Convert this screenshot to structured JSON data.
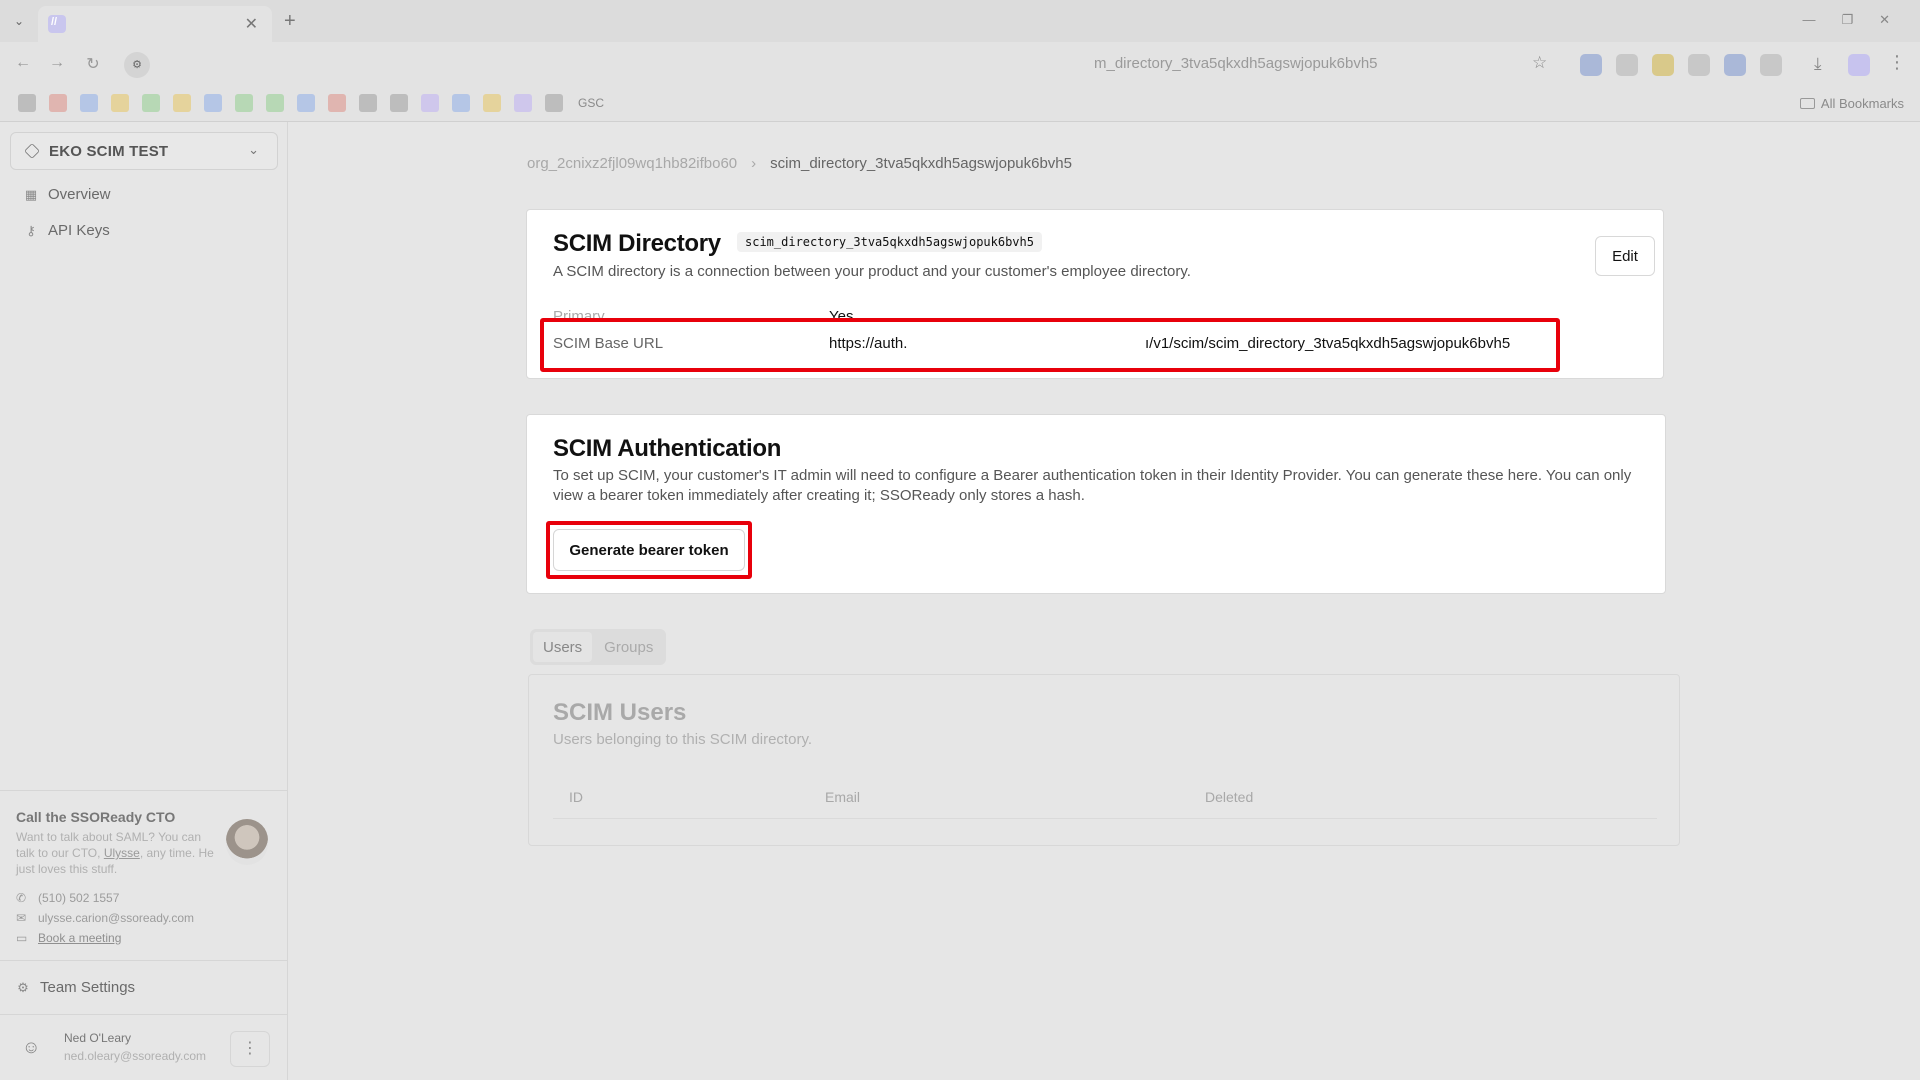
{
  "browser": {
    "tab_title": "",
    "url": "m_directory_3tva5qkxdh5agswjopuk6bvh5",
    "bookmark_gsc": "GSC",
    "all_bookmarks": "All Bookmarks"
  },
  "sidebar": {
    "org_name": "EKO SCIM TEST",
    "nav": [
      {
        "label": "Overview",
        "icon": "grid-icon"
      },
      {
        "label": "API Keys",
        "icon": "key-icon"
      }
    ],
    "cto": {
      "title": "Call the SSOReady CTO",
      "text_before": "Want to talk about SAML? You can talk to our CTO, ",
      "text_link": "Ulysse",
      "text_after": ", any time. He just loves this stuff.",
      "phone": "(510) 502 1557",
      "email": "ulysse.carion@ssoready.com",
      "meeting": "Book a meeting"
    },
    "team_settings": "Team Settings",
    "user": {
      "name": "Ned O'Leary",
      "email": "ned.oleary@ssoready.com"
    }
  },
  "breadcrumb": {
    "org": "org_2cnixz2fjl09wq1hb82ifbo60",
    "separator": "›",
    "current": "scim_directory_3tva5qkxdh5agswjopuk6bvh5"
  },
  "directory": {
    "title": "SCIM Directory",
    "id": "scim_directory_3tva5qkxdh5agswjopuk6bvh5",
    "description": "A SCIM directory is a connection between your product and your customer's employee directory.",
    "edit_label": "Edit",
    "primary_label": "Primary",
    "primary_value": "Yes",
    "base_url_label": "SCIM Base URL",
    "base_url_start": "https://auth.",
    "base_url_end": "ı/v1/scim/scim_directory_3tva5qkxdh5agswjopuk6bvh5"
  },
  "auth": {
    "title": "SCIM Authentication",
    "description": "To set up SCIM, your customer's IT admin will need to configure a Bearer authentication token in their Identity Provider. You can generate these here. You can only view a bearer token immediately after creating it; SSOReady only stores a hash.",
    "button_label": "Generate bearer token"
  },
  "tabs": [
    {
      "label": "Users",
      "active": true
    },
    {
      "label": "Groups",
      "active": false
    }
  ],
  "users": {
    "title": "SCIM Users",
    "description": "Users belonging to this SCIM directory.",
    "columns": [
      "ID",
      "Email",
      "Deleted"
    ]
  },
  "colors": {
    "highlight": "#e8000b",
    "card_bg": "#ffffff",
    "page_bg": "#e6e6e6"
  }
}
